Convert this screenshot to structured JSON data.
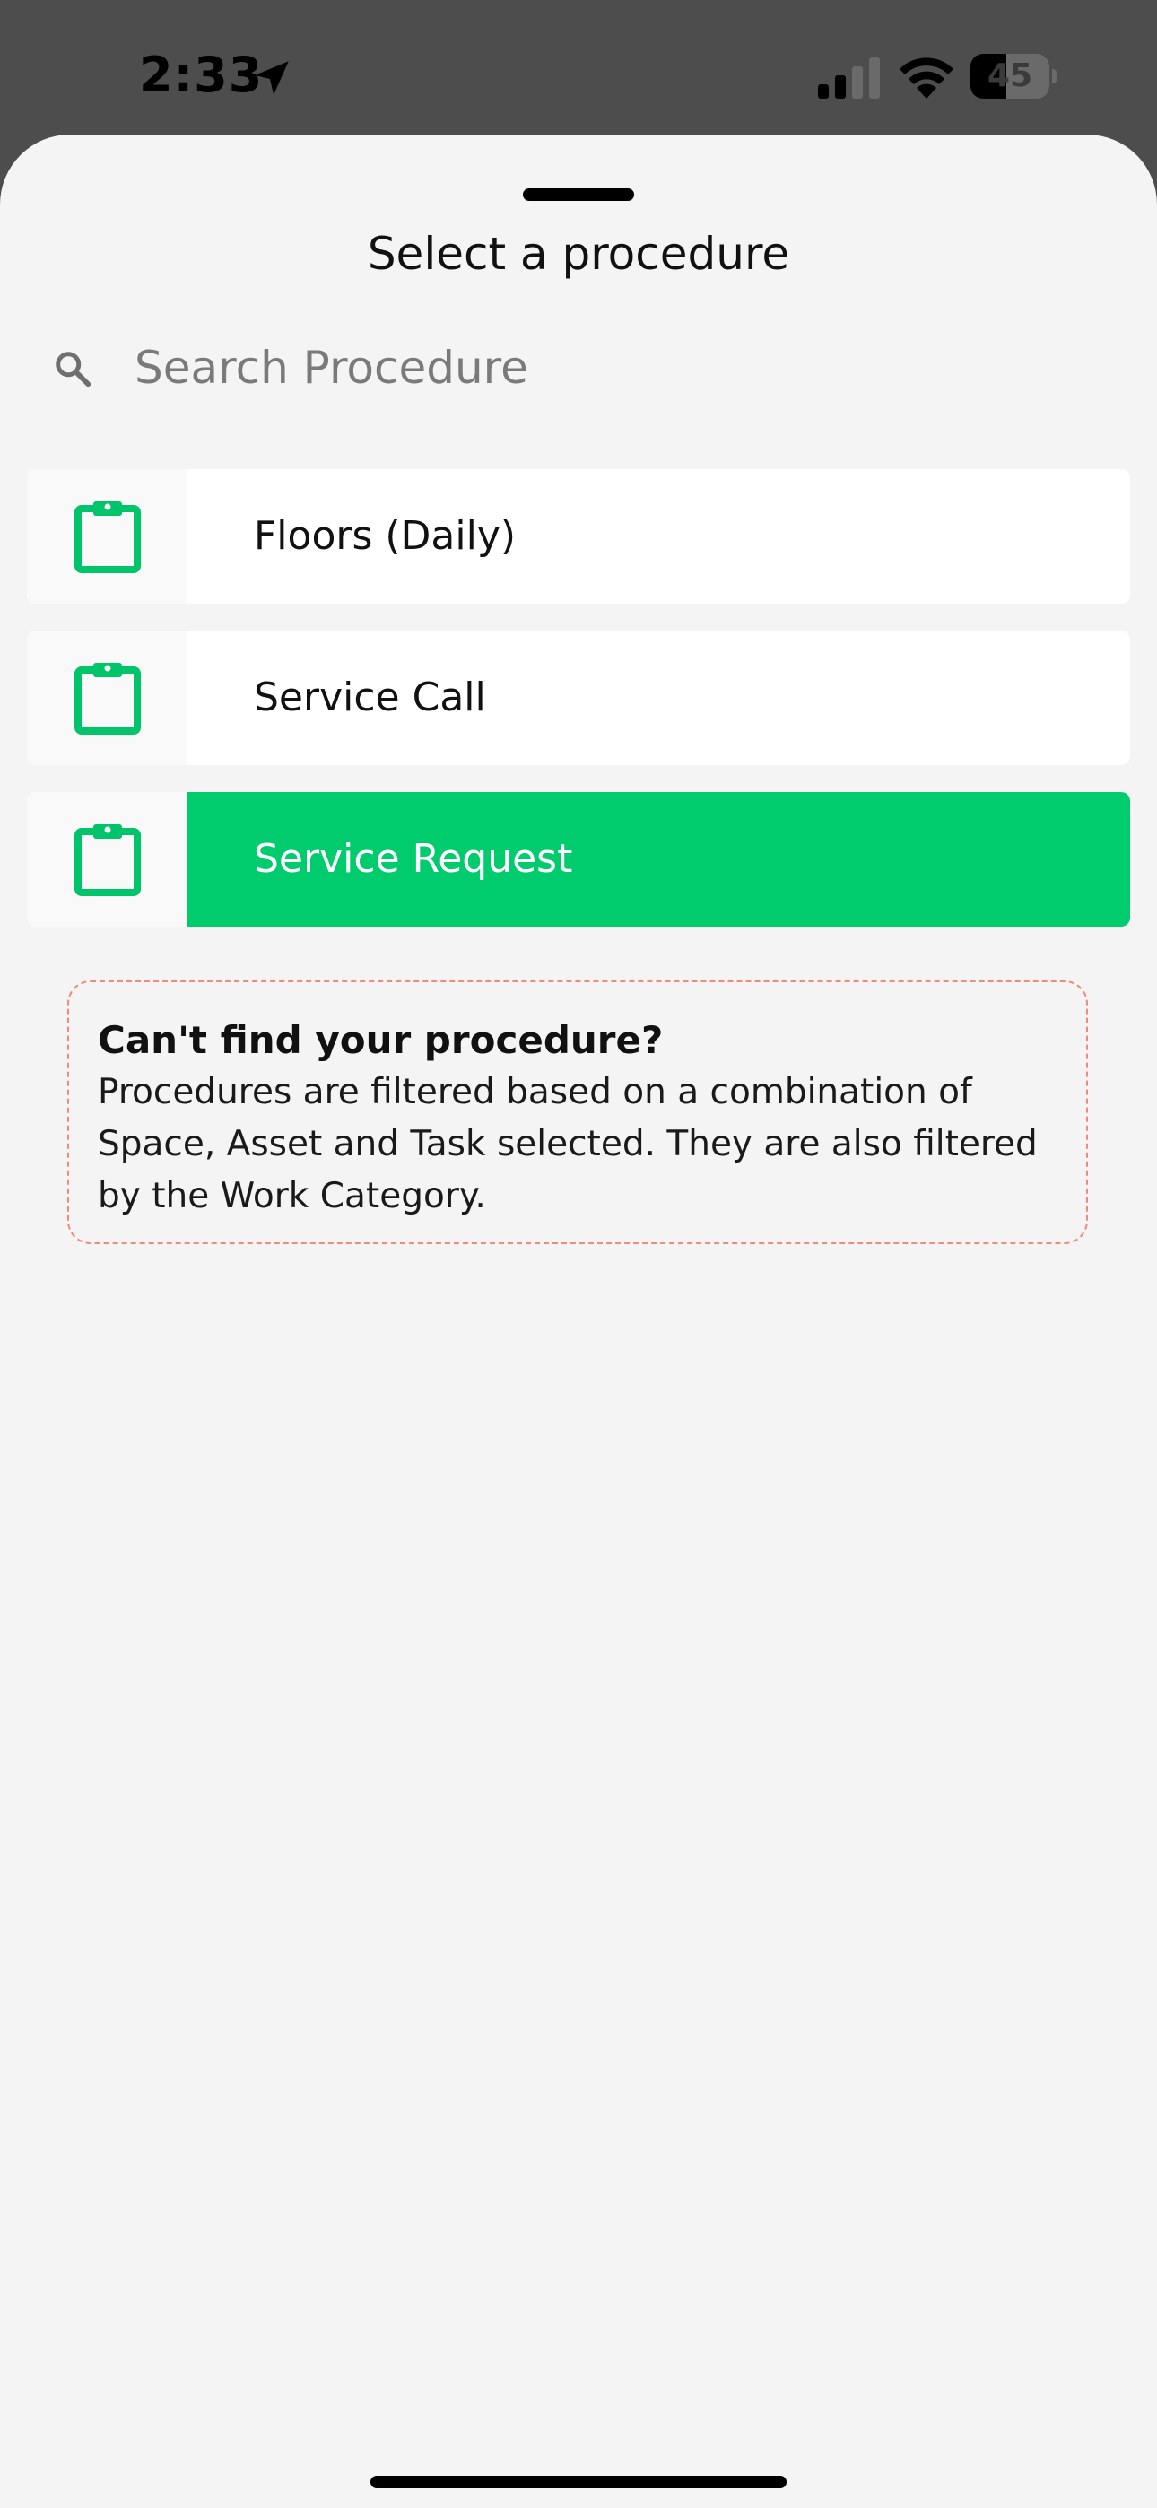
{
  "status_bar": {
    "time": "2:33",
    "battery": "45",
    "battery_level": 0.45
  },
  "sheet": {
    "title": "Select a procedure"
  },
  "search": {
    "value": "",
    "placeholder": "Search Procedure"
  },
  "procedures": [
    {
      "label": "Floors (Daily)",
      "selected": false
    },
    {
      "label": "Service Call",
      "selected": false
    },
    {
      "label": "Service Request",
      "selected": true
    }
  ],
  "notice": {
    "title": "Can't find your procedure?",
    "body": "Procedures are filtered based on a combination of Space, Asset and Task selected. They are also filtered by the Work Category."
  },
  "colors": {
    "accent": "#00cc6e",
    "notice_border": "#f08a7a",
    "sheet_background": "#f4f4f4"
  },
  "icons": {
    "procedure": "clipboard-icon",
    "search": "search-icon",
    "location": "location-arrow-icon"
  }
}
